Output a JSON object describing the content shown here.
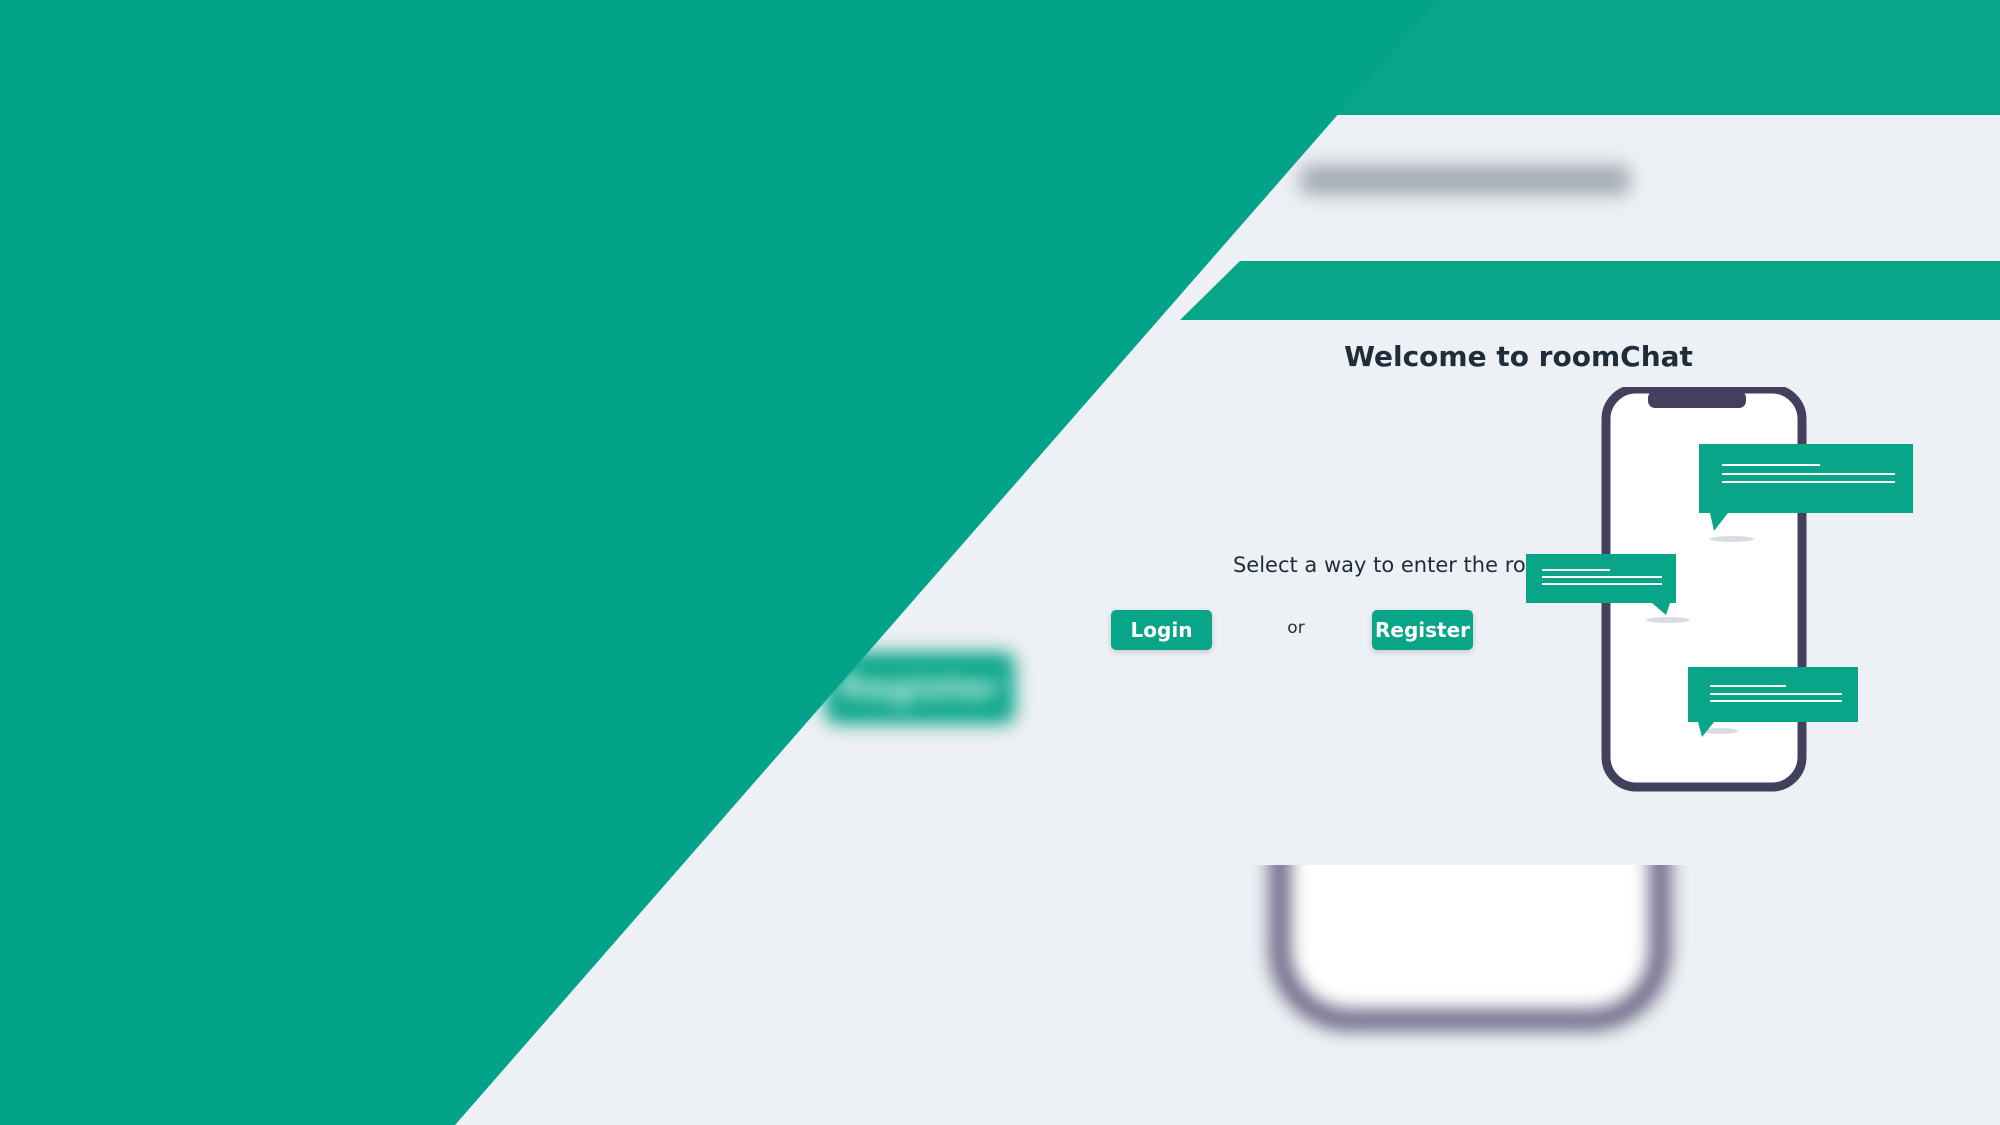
{
  "app": {
    "title": "Welcome to roomChat",
    "prompt": "Select a way to enter the room",
    "separator": "or"
  },
  "buttons": {
    "login_label": "Login",
    "register_label": "Register"
  },
  "background": {
    "ghost_button_label": "Register"
  },
  "colors": {
    "brand": "#08a589",
    "background": "#edf0f4",
    "text": "#1f2d3b",
    "phone_frame": "#43405d"
  },
  "icons": {
    "illustration": "phone-chat-illustration"
  }
}
